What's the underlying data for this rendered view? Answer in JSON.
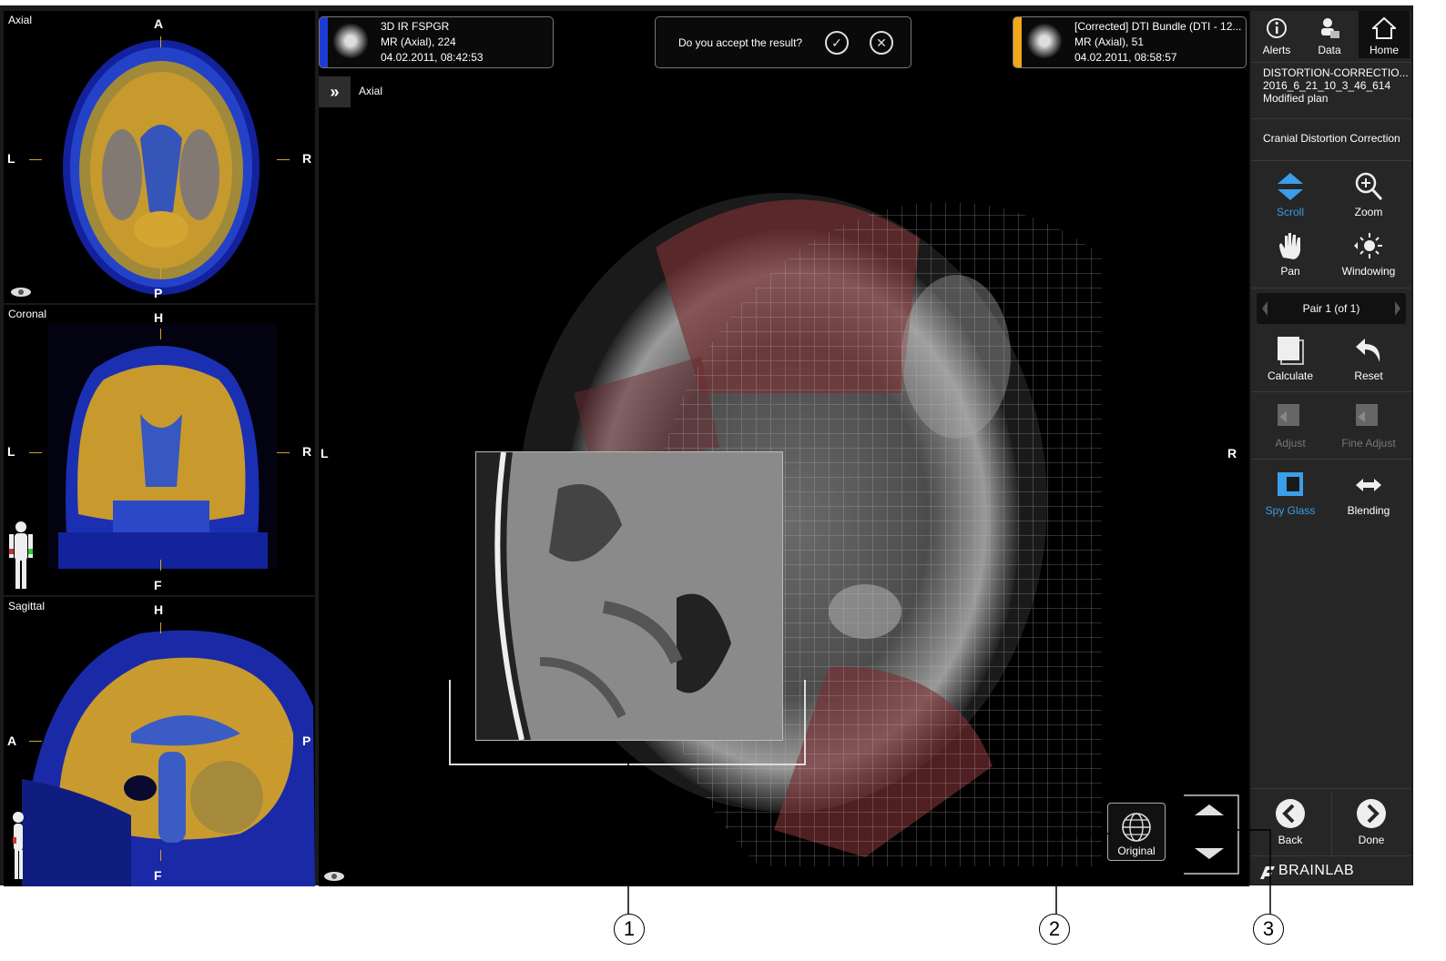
{
  "views": {
    "axial": {
      "label": "Axial",
      "top": "A",
      "bottom": "P",
      "left": "L",
      "right": "R"
    },
    "coronal": {
      "label": "Coronal",
      "top": "H",
      "bottom": "F",
      "left": "L",
      "right": "R"
    },
    "sagittal": {
      "label": "Sagittal",
      "top": "H",
      "bottom": "F",
      "left": "A",
      "right": "P"
    }
  },
  "main": {
    "label": "Axial",
    "left": "L",
    "right": "R",
    "expand_glyph": "»",
    "reference_series": {
      "name": "3D IR FSPGR",
      "info": "MR (Axial), 224",
      "date": "04.02.2011, 08:42:53",
      "color": "#1f3bd6"
    },
    "corrected_series": {
      "name": "[Corrected] DTI Bundle (DTI - 12...",
      "info": "MR (Axial), 51",
      "date": "04.02.2011, 08:58:57",
      "color": "#f2a71b"
    },
    "accept_prompt": "Do you accept the result?",
    "accept_glyph": "✓",
    "reject_glyph": "✕",
    "original_label": "Original"
  },
  "panel": {
    "nav": [
      {
        "label": "Alerts",
        "icon": "info-icon"
      },
      {
        "label": "Data",
        "icon": "data-icon"
      },
      {
        "label": "Home",
        "icon": "home-icon"
      }
    ],
    "plan_name": "DISTORTION-CORRECTIO...",
    "plan_id": "2016_6_21_10_3_46_614",
    "plan_status": "Modified plan",
    "task": "Cranial Distortion Correction",
    "tools": {
      "scroll": "Scroll",
      "zoom": "Zoom",
      "pan": "Pan",
      "windowing": "Windowing",
      "calculate": "Calculate",
      "reset": "Reset",
      "adjust": "Adjust",
      "fine_adjust": "Fine Adjust",
      "spy_glass": "Spy Glass",
      "blending": "Blending"
    },
    "pair": "Pair 1 (of 1)",
    "back": "Back",
    "done": "Done",
    "brand": "BRAINLAB"
  },
  "callouts": [
    "1",
    "2",
    "3"
  ],
  "colors": {
    "accent_blue": "#3a9ee8",
    "overlay_gold": "#d2a22a",
    "overlay_blue": "#2a4fd6"
  }
}
